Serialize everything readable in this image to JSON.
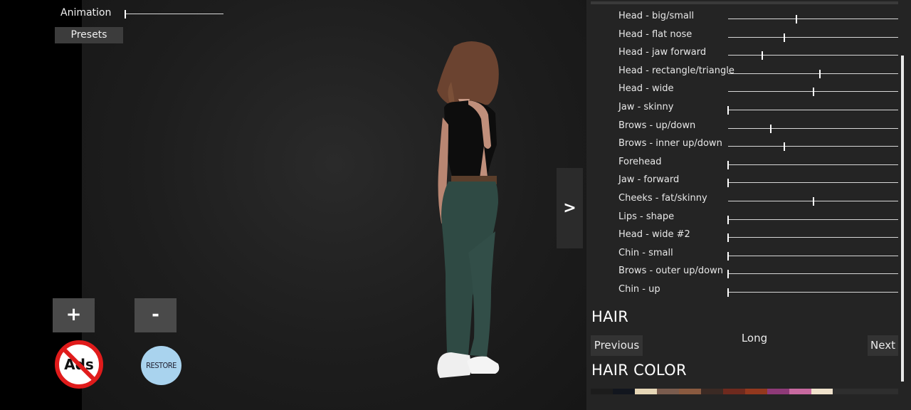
{
  "top_left": {
    "animation_label": "Animation",
    "animation_value": 0.0,
    "presets_label": "Presets"
  },
  "zoom": {
    "plus_label": "+",
    "minus_label": "-"
  },
  "badges": {
    "no_ads_text": "Ads",
    "restore_label": "RESTORE"
  },
  "panel_toggle_label": ">",
  "morphs": [
    {
      "label": "Head - big/small",
      "value": 0.4
    },
    {
      "label": "Head - flat nose",
      "value": 0.33
    },
    {
      "label": "Head - jaw forward",
      "value": 0.2
    },
    {
      "label": "Head - rectangle/triangle",
      "value": 0.54
    },
    {
      "label": "Head - wide",
      "value": 0.5
    },
    {
      "label": "Jaw - skinny",
      "value": 0.0
    },
    {
      "label": "Brows - up/down",
      "value": 0.25
    },
    {
      "label": "Brows - inner up/down",
      "value": 0.33
    },
    {
      "label": "Forehead",
      "value": 0.0
    },
    {
      "label": "Jaw - forward",
      "value": 0.0
    },
    {
      "label": "Cheeks - fat/skinny",
      "value": 0.5
    },
    {
      "label": "Lips - shape",
      "value": 0.0
    },
    {
      "label": "Head - wide #2",
      "value": 0.0
    },
    {
      "label": "Chin - small",
      "value": 0.0
    },
    {
      "label": "Brows - outer up/down",
      "value": 0.0
    },
    {
      "label": "Chin - up",
      "value": 0.0
    }
  ],
  "hair": {
    "title": "HAIR",
    "previous_label": "Previous",
    "current_style": "Long",
    "next_label": "Next"
  },
  "hair_color": {
    "title": "HAIR COLOR",
    "swatches": [
      "#1c1c1c",
      "#12161e",
      "#e6d6b6",
      "#7a5c4e",
      "#8a5a40",
      "#3b2a24",
      "#6e2a1e",
      "#93381e",
      "#8e3a78",
      "#c86aa0",
      "#f0e2cc"
    ]
  }
}
